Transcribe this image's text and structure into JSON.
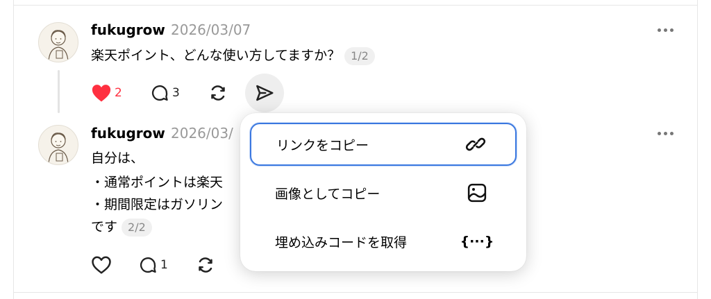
{
  "posts": [
    {
      "username": "fukugrow",
      "date": "2026/03/07",
      "lines": [
        "楽天ポイント、どんな使い方してますか？"
      ],
      "page_badge": "1/2",
      "likes": "2",
      "liked": true,
      "comments": "3"
    },
    {
      "username": "fukugrow",
      "date": "2026/03/",
      "lines": [
        "自分は、",
        "・通常ポイントは楽天",
        "・期間限定はガソリン",
        "です"
      ],
      "page_badge": "2/2",
      "comments": "1"
    }
  ],
  "share_menu": {
    "items": [
      {
        "label": "リンクをコピー",
        "icon": "link-icon"
      },
      {
        "label": "画像としてコピー",
        "icon": "image-icon"
      },
      {
        "label": "埋め込みコードを取得",
        "icon": "embed-code-icon",
        "icon_text": "{···}"
      }
    ]
  },
  "colors": {
    "like_red": "#ff3040",
    "focus_blue": "#3b78e0",
    "muted_gray": "#999999"
  }
}
